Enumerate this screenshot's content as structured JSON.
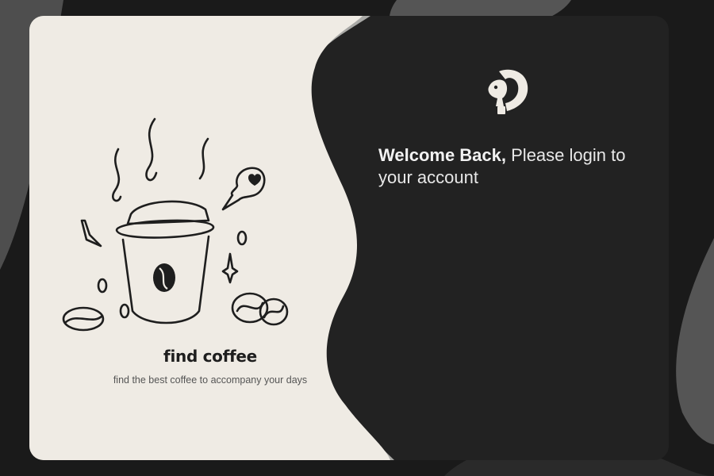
{
  "left_panel": {
    "title": "find coffee",
    "subtitle": "find the best coffee to accompany your days"
  },
  "login_panel": {
    "welcome_bold": "Welcome Back,",
    "welcome_rest": " Please login to your account"
  },
  "icons": {
    "logo": "squirrel-coffee-logo-icon",
    "illustration": "coffee-cup-illustration"
  },
  "colors": {
    "page_background": "#1a1a1a",
    "card_dark": "#222222",
    "left_panel_cream": "#efebe4",
    "accent_grey": "#a9a9a6",
    "text_light": "#e8e8e8",
    "text_dark": "#1e1e1e"
  }
}
